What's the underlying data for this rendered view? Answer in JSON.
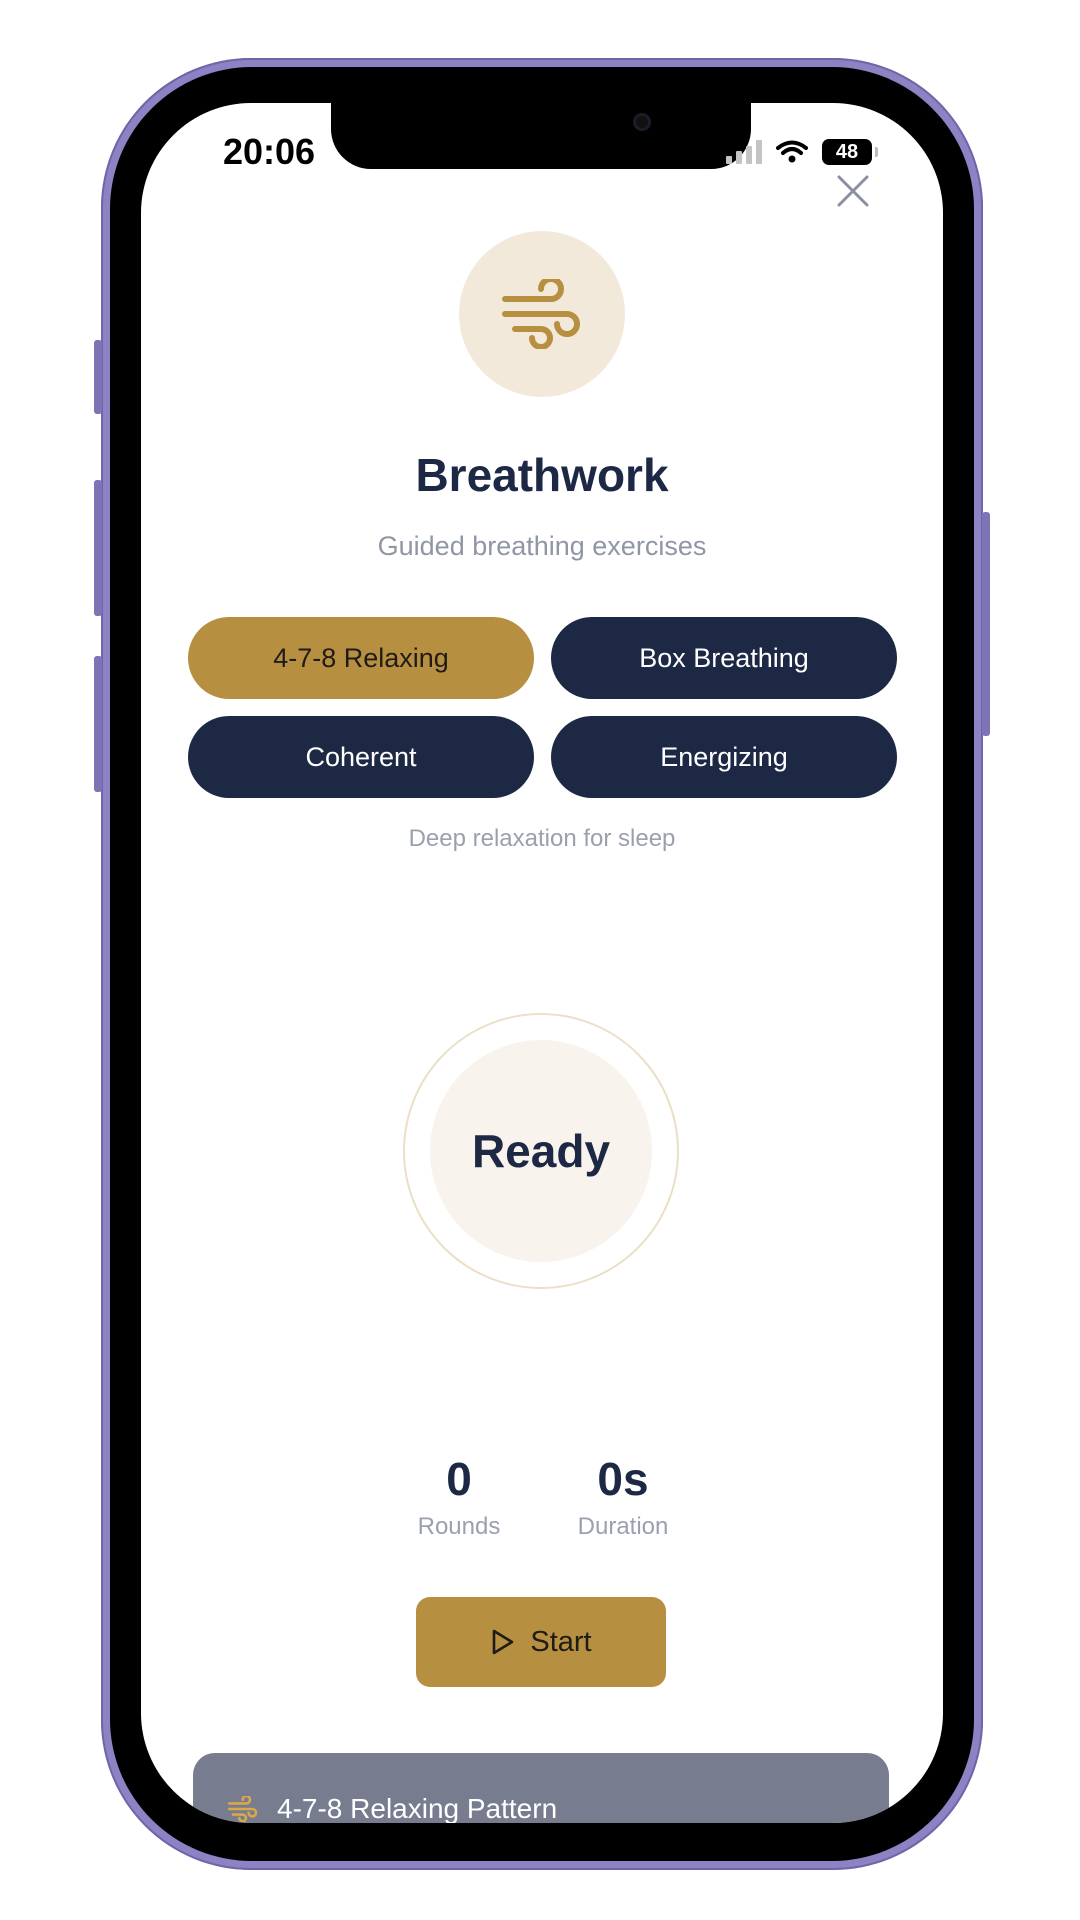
{
  "status_bar": {
    "time": "20:06",
    "battery": "48"
  },
  "header": {
    "close_icon": "close-icon",
    "hero_icon": "wind-icon",
    "title": "Breathwork",
    "subtitle": "Guided breathing exercises"
  },
  "techniques": [
    {
      "label": "4-7-8 Relaxing",
      "active": true
    },
    {
      "label": "Box Breathing",
      "active": false
    },
    {
      "label": "Coherent",
      "active": false
    },
    {
      "label": "Energizing",
      "active": false
    }
  ],
  "technique_description": "Deep relaxation for sleep",
  "breath_circle": {
    "state": "Ready"
  },
  "stats": {
    "rounds_value": "0",
    "rounds_label": "Rounds",
    "duration_value": "0s",
    "duration_label": "Duration"
  },
  "start_button": {
    "label": "Start",
    "icon": "play-icon"
  },
  "pattern_card": {
    "label": "4-7-8 Relaxing Pattern",
    "icon": "wind-icon"
  },
  "colors": {
    "accent": "#b78f41",
    "navy": "#1c2844",
    "hero_bg": "#f2e9da",
    "muted_text": "#8f96a6",
    "device_frame": "#8c82c4"
  }
}
